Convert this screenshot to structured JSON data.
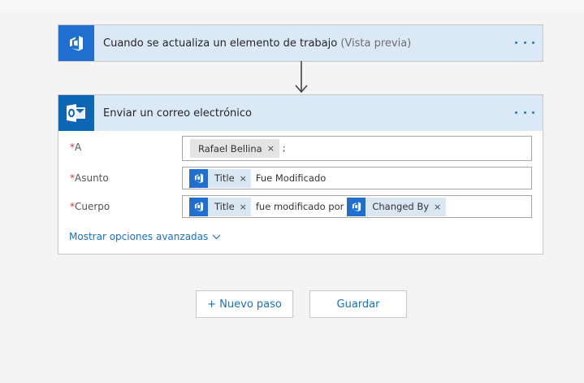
{
  "trigger": {
    "title": "Cuando se actualiza un elemento de trabajo",
    "preview_tag": "(Vista previa)",
    "icon": "vsts-icon",
    "accent": "#1f6fd0"
  },
  "action": {
    "title": "Enviar un correo electrónico",
    "icon": "outlook-icon",
    "accent": "#0c65b5",
    "fields": {
      "to": {
        "required_mark": "*",
        "label": "A",
        "token": "Rafael Bellina",
        "separator": ";"
      },
      "subject": {
        "required_mark": "*",
        "label": "Asunto",
        "token": "Title",
        "text": "Fue Modificado"
      },
      "body": {
        "required_mark": "*",
        "label": "Cuerpo",
        "token1": "Title",
        "text": "fue modificado por",
        "token2": "Changed By"
      }
    },
    "advanced_link": "Mostrar opciones avanzadas",
    "token_remove": "×"
  },
  "buttons": {
    "new_step": "+ Nuevo paso",
    "save": "Guardar"
  },
  "colors": {
    "header_bg": "#dbe9f7",
    "link": "#1b6fbe",
    "required": "#d13438"
  }
}
